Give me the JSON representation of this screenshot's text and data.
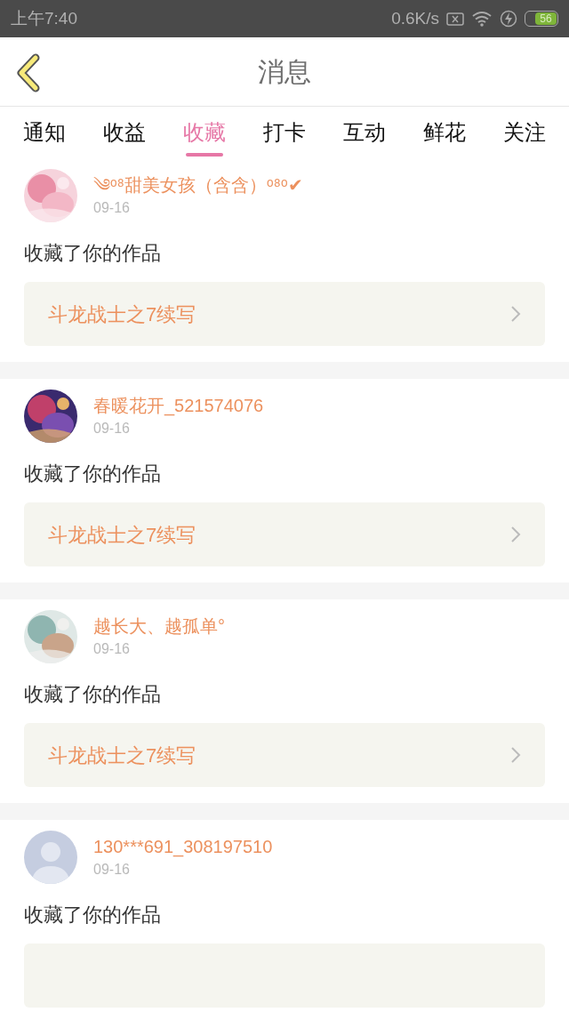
{
  "status_bar": {
    "time": "上午7:40",
    "speed": "0.6K/s",
    "battery": "56"
  },
  "header": {
    "title": "消息"
  },
  "tabs": [
    {
      "label": "通知",
      "selected": false
    },
    {
      "label": "收益",
      "selected": false
    },
    {
      "label": "收藏",
      "selected": true
    },
    {
      "label": "打卡",
      "selected": false
    },
    {
      "label": "互动",
      "selected": false
    },
    {
      "label": "鲜花",
      "selected": false
    },
    {
      "label": "关注",
      "selected": false
    }
  ],
  "messages": [
    {
      "name": "༄ᵒ⁸甜美女孩（含含）ᵒ⁸ᵒ✔",
      "date": "09-16",
      "text": "收藏了你的作品",
      "work": "斗龙战士之7续写"
    },
    {
      "name": "春暖花开_521574076",
      "date": "09-16",
      "text": "收藏了你的作品",
      "work": "斗龙战士之7续写"
    },
    {
      "name": "越长大、越孤单°",
      "date": "09-16",
      "text": "收藏了你的作品",
      "work": "斗龙战士之7续写"
    },
    {
      "avatar": {
        "kind": "silhouette"
      },
      "name": "130***691_308197510",
      "date": "09-16",
      "text": "收藏了你的作品"
    }
  ]
}
